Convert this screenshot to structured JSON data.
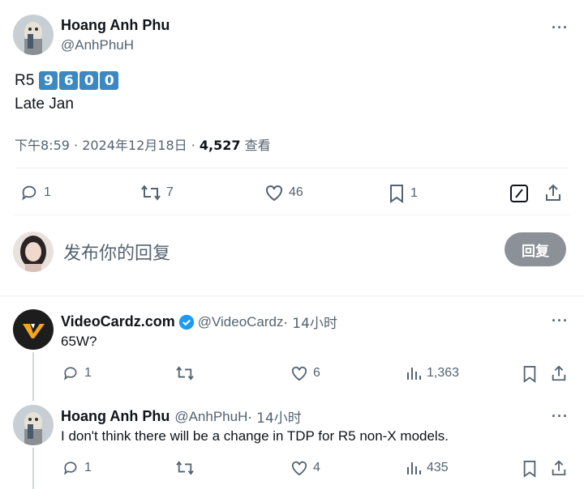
{
  "main_tweet": {
    "author_name": "Hoang Anh Phu",
    "author_handle": "@AnhPhuH",
    "text_prefix": "R5",
    "keycaps": [
      "9",
      "6",
      "0",
      "0"
    ],
    "text_line2": "Late Jan",
    "meta_time": "下午8:59 · 2024年12月18日 · ",
    "meta_views_count": "4,527",
    "meta_views_label": " 查看",
    "actions": {
      "replies": "1",
      "retweets": "7",
      "likes": "46",
      "bookmarks": "1"
    },
    "more_icon": "more-horizontal-icon"
  },
  "reply_composer": {
    "placeholder": "发布你的回复",
    "button_label": "回复"
  },
  "replies": [
    {
      "author_name": "VideoCardz.com",
      "verified": true,
      "author_handle": "@VideoCardz",
      "time": " · 14小时",
      "text": "65W?",
      "actions": {
        "replies": "1",
        "retweets": "",
        "likes": "6",
        "views": "1,363"
      }
    },
    {
      "author_name": "Hoang Anh Phu",
      "verified": false,
      "author_handle": "@AnhPhuH",
      "time": " · 14小时",
      "text": "I don't think there will be a change in TDP for R5 non-X models.",
      "actions": {
        "replies": "1",
        "retweets": "",
        "likes": "4",
        "views": "435"
      }
    }
  ],
  "colors": {
    "accent_keycap": "#3b88c3",
    "verified_badge": "#1d9bf0",
    "muted_text": "#536471",
    "reply_button_bg": "#8b9196"
  }
}
